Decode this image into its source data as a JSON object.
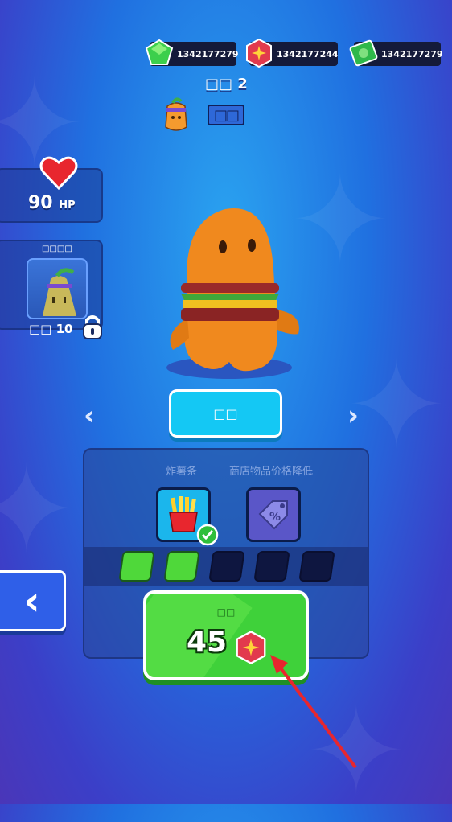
{
  "currencies": [
    {
      "name": "gem",
      "value": "1342177279",
      "color": "#3ccf4c"
    },
    {
      "name": "token",
      "value": "1342177244",
      "color": "#e23a4d"
    },
    {
      "name": "cash",
      "value": "1342177279",
      "color": "#2fb84a"
    }
  ],
  "player": {
    "level_label": "□□ 2",
    "rank_box": "□□"
  },
  "stats": {
    "hp_value": "90",
    "hp_unit": "HP"
  },
  "companion": {
    "title": "□□□□",
    "unlock_label": "□□ 10"
  },
  "select_button": {
    "label": "□□"
  },
  "upgrades": {
    "left_name": "炸薯条",
    "right_name": "商店物品价格降低",
    "progress_filled": 2,
    "progress_total": 5
  },
  "buy_button": {
    "label": "□□",
    "price": "45"
  },
  "colors": {
    "accent_green": "#3fd13a",
    "cyan": "#14c8f4",
    "panel": "#2a4696",
    "annotation_arrow": "#e8262e"
  }
}
